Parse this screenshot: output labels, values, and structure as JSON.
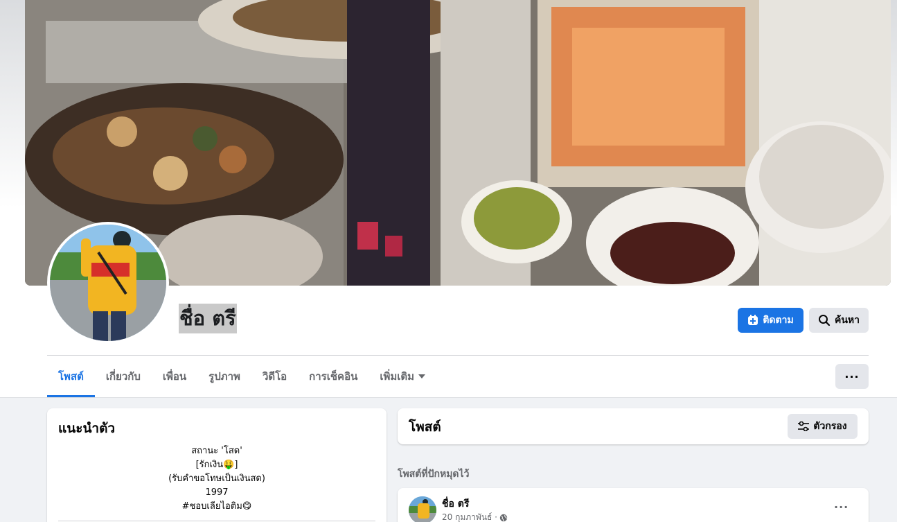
{
  "profile": {
    "name": "ชื่อ ตรี",
    "follow_label": "ติดตาม",
    "search_label": "ค้นหา"
  },
  "tabs": [
    {
      "label": "โพสต์",
      "active": true
    },
    {
      "label": "เกี่ยวกับ"
    },
    {
      "label": "เพื่อน"
    },
    {
      "label": "รูปภาพ"
    },
    {
      "label": "วิดีโอ"
    },
    {
      "label": "การเช็คอิน"
    },
    {
      "label": "เพิ่มเติม"
    }
  ],
  "more_label": "···",
  "intro": {
    "title": "แนะนำตัว",
    "bio": [
      "สถานะ 'โสด'",
      "[รักเงิน🤑]",
      "(รับคำขอโทษเป็นเงินสด)",
      "1997",
      "#ชอบเลียไอติม😋"
    ]
  },
  "posts": {
    "title": "โพสต์",
    "filter_label": "ตัวกรอง",
    "pinned_label": "โพสต์ที่ปักหมุดไว้",
    "pinned_post": {
      "author": "ชื่อ ตรี",
      "date": "20 กุมภาพันธ์ ·",
      "more_label": "···"
    }
  },
  "colors": {
    "accent": "#1b74e4",
    "secondary_button": "#e4e6eb",
    "page_background": "#f0f2f5"
  },
  "icons": {
    "follow": "follow-plus-icon",
    "search": "search-icon",
    "filter": "filter-sliders-icon",
    "dropdown": "caret-down-icon",
    "privacy": "globe-icon"
  }
}
